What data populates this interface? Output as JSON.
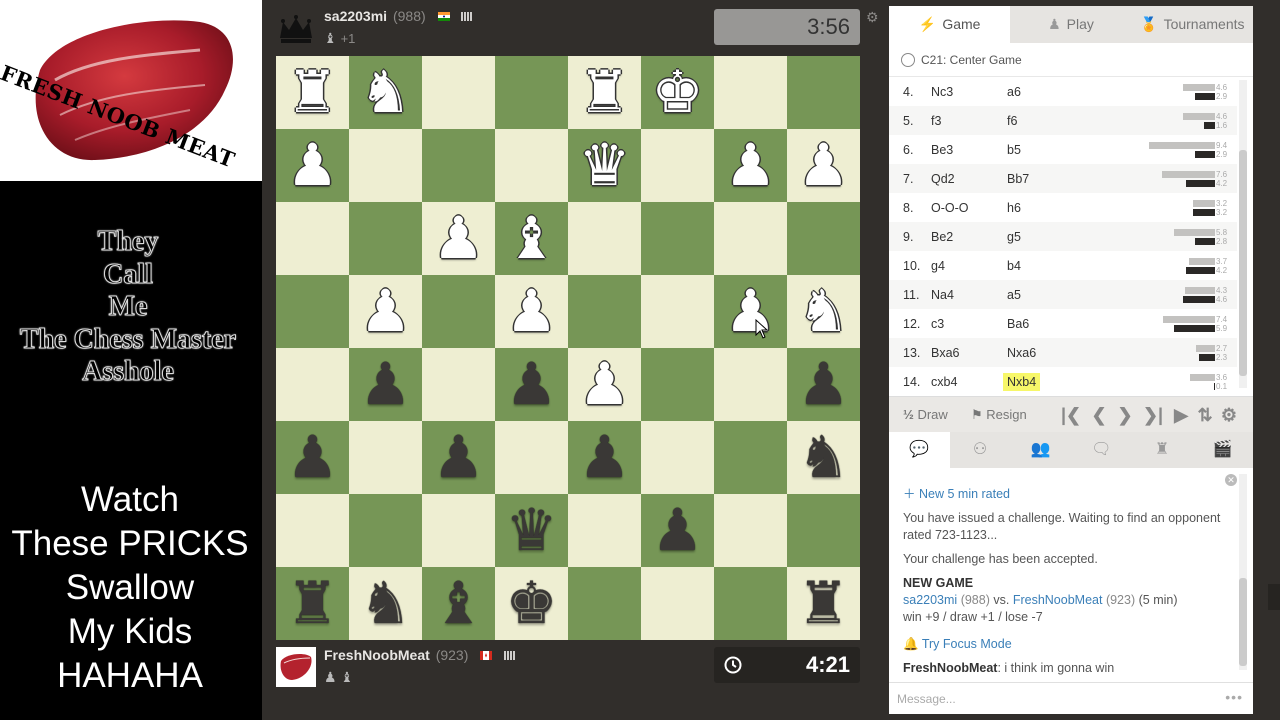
{
  "overlay": {
    "logo_text": "FRESH NOOB MEAT",
    "caption_top": [
      "They",
      "Call",
      "Me",
      "The Chess Master",
      "Asshole"
    ],
    "caption_bottom": [
      "Watch",
      "These PRICKS",
      "Swallow",
      "My Kids",
      "HAHAHA"
    ]
  },
  "top_player": {
    "name": "sa2203mi",
    "rating": "(988)",
    "material": "+1",
    "captured": [
      "♝"
    ],
    "clock": "3:56",
    "flag_colors": [
      "#ff9933",
      "#ffffff",
      "#138808"
    ]
  },
  "bottom_player": {
    "name": "FreshNoobMeat",
    "rating": "(923)",
    "captured": [
      "♟",
      "♝"
    ],
    "clock": "4:21",
    "flag_colors": [
      "#d52b1e",
      "#ffffff",
      "#d52b1e"
    ]
  },
  "board": {
    "light_color": "#eeeed2",
    "dark_color": "#769656",
    "ranks": [
      [
        "wR",
        "wN",
        "",
        "",
        "wR",
        "wK",
        "",
        ""
      ],
      [
        "wP",
        "",
        "",
        "",
        "wQ",
        "",
        "wP",
        "wP"
      ],
      [
        "",
        "",
        "wP",
        "wB",
        "",
        "",
        "",
        ""
      ],
      [
        "",
        "wP",
        "",
        "wP",
        "",
        "",
        "wP",
        "wN"
      ],
      [
        "",
        "bP",
        "",
        "bP",
        "wP",
        "",
        "",
        "bP"
      ],
      [
        "bP",
        "",
        "bP",
        "",
        "bP",
        "",
        "",
        "bN"
      ],
      [
        "",
        "",
        "",
        "bQ",
        "",
        "bP",
        "",
        ""
      ],
      [
        "bR",
        "bN",
        "bB",
        "bK",
        "",
        "",
        "",
        "bR"
      ]
    ]
  },
  "tabs": [
    {
      "icon": "⚡",
      "label": "Game",
      "active": true
    },
    {
      "icon": "♟",
      "label": "Play",
      "active": false
    },
    {
      "icon": "🏅",
      "label": "Tournaments",
      "active": false
    }
  ],
  "opening": "C21: Center Game",
  "moves": [
    {
      "num": "4.",
      "white": "Nc3",
      "black": "a6",
      "w_time": 4.6,
      "b_time": 2.9
    },
    {
      "num": "5.",
      "white": "f3",
      "black": "f6",
      "w_time": 4.6,
      "b_time": 1.6
    },
    {
      "num": "6.",
      "white": "Be3",
      "black": "b5",
      "w_time": 9.4,
      "b_time": 2.9
    },
    {
      "num": "7.",
      "white": "Qd2",
      "black": "Bb7",
      "w_time": 7.6,
      "b_time": 4.2
    },
    {
      "num": "8.",
      "white": "O-O-O",
      "black": "h6",
      "w_time": 3.2,
      "b_time": 3.2
    },
    {
      "num": "9.",
      "white": "Be2",
      "black": "g5",
      "w_time": 5.8,
      "b_time": 2.8
    },
    {
      "num": "10.",
      "white": "g4",
      "black": "b4",
      "w_time": 3.7,
      "b_time": 4.2
    },
    {
      "num": "11.",
      "white": "Na4",
      "black": "a5",
      "w_time": 4.3,
      "b_time": 4.6
    },
    {
      "num": "12.",
      "white": "c3",
      "black": "Ba6",
      "w_time": 7.4,
      "b_time": 5.9
    },
    {
      "num": "13.",
      "white": "Bxa6",
      "black": "Nxa6",
      "w_time": 2.7,
      "b_time": 2.3
    },
    {
      "num": "14.",
      "white": "cxb4",
      "black": "Nxb4",
      "w_time": 3.6,
      "b_time": 0.1,
      "highlight": true
    }
  ],
  "controls": {
    "draw_icon": "½",
    "draw_label": "Draw",
    "resign_label": "Resign"
  },
  "chat": {
    "new_game_link": "New 5 min rated",
    "challenge_msg": "You have issued a challenge. Waiting to find an opponent rated 723-1123...",
    "accepted_msg": "Your challenge has been accepted.",
    "new_game_title": "NEW GAME",
    "p1_name": "sa2203mi",
    "p1_rating": "(988)",
    "vs": "vs.",
    "p2_name": "FreshNoobMeat",
    "p2_rating": "(923)",
    "mode": "(5 min)",
    "record": "win +9 / draw +1 / lose -7",
    "focus_link": "Try Focus Mode",
    "msg_author": "FreshNoobMeat",
    "msg_text": ": i think im gonna win",
    "input_placeholder": "Message..."
  }
}
